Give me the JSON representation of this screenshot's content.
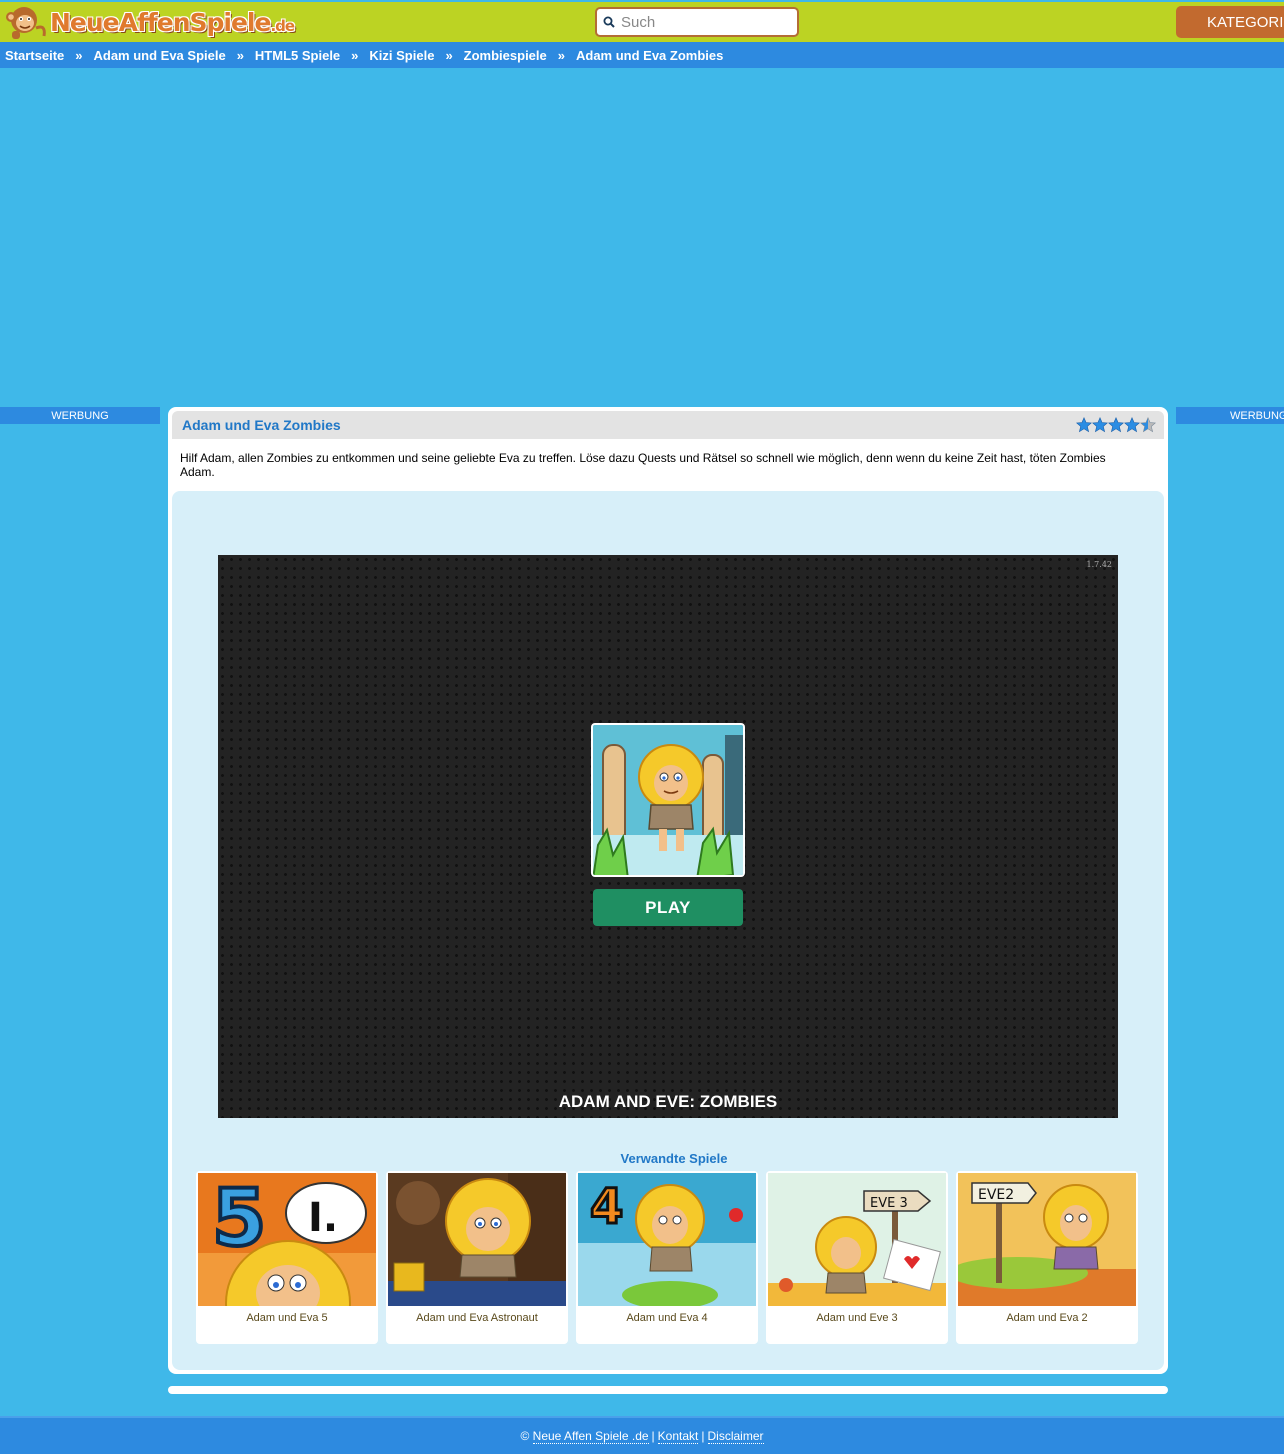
{
  "header": {
    "logo_main": "NeueAffenSpiele",
    "logo_suffix": ".de",
    "search_placeholder": "Such",
    "menu_label": "KATEGORIEN"
  },
  "breadcrumb": [
    "Startseite",
    "Adam und Eva Spiele",
    "HTML5 Spiele",
    "Kizi Spiele",
    "Zombiespiele",
    "Adam und Eva Zombies"
  ],
  "breadcrumb_sep": "»",
  "ads": {
    "left_label": "WERBUNG",
    "right_label": "WERBUNG"
  },
  "game": {
    "title": "Adam und Eva Zombies",
    "rating": {
      "value": 4.5,
      "max": 5
    },
    "description": "Hilf Adam, allen Zombies zu entkommen und seine geliebte Eva zu treffen. Löse dazu Quests und Rätsel so schnell wie möglich, denn wenn du keine Zeit hast, töten Zombies Adam.",
    "version": "1.7.42",
    "play_label": "PLAY",
    "canvas_title": "ADAM AND EVE: ZOMBIES"
  },
  "related": {
    "title": "Verwandte Spiele",
    "items": [
      {
        "label": "Adam und Eva 5",
        "badge": "5",
        "badge2": "I."
      },
      {
        "label": "Adam und Eva Astronaut"
      },
      {
        "label": "Adam und Eva 4",
        "badge": "4"
      },
      {
        "label": "Adam und Eve 3",
        "sign": "EVE 3"
      },
      {
        "label": "Adam und Eva 2",
        "sign": "EVE2"
      }
    ]
  },
  "footer": {
    "copyright": "©",
    "site_link": "Neue Affen Spiele .de",
    "contact": "Kontakt",
    "disclaimer": "Disclaimer",
    "pipe": "|"
  },
  "colors": {
    "background": "#3fb8e9",
    "header": "#bcd323",
    "nav": "#2d8ae0",
    "accent_orange": "#c26a2f",
    "play_green": "#1f8f62",
    "title_blue": "#2178c7"
  }
}
